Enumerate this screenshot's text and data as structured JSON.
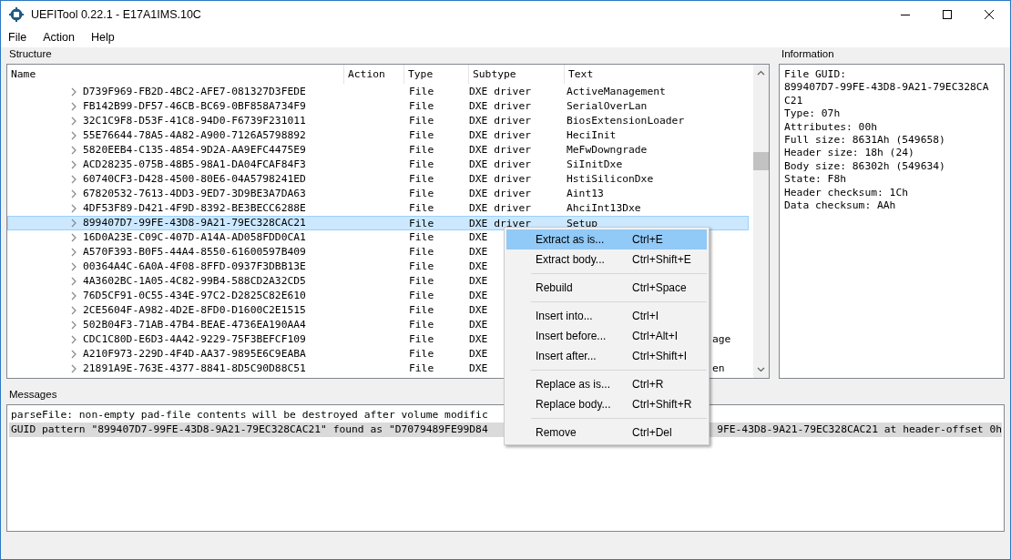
{
  "window": {
    "title": "UEFITool 0.22.1 - E17A1IMS.10C"
  },
  "menu_bar": [
    "File",
    "Action",
    "Help"
  ],
  "structure": {
    "label": "Structure",
    "columns": [
      "Name",
      "Action",
      "Type",
      "Subtype",
      "Text"
    ],
    "rows": [
      {
        "name": "D739F969-FB2D-4BC2-AFE7-081327D3FEDE",
        "type": "File",
        "subtype": "DXE driver",
        "text": "ActiveManagement",
        "selected": false
      },
      {
        "name": "FB142B99-DF57-46CB-BC69-0BF858A734F9",
        "type": "File",
        "subtype": "DXE driver",
        "text": "SerialOverLan",
        "selected": false
      },
      {
        "name": "32C1C9F8-D53F-41C8-94D0-F6739F231011",
        "type": "File",
        "subtype": "DXE driver",
        "text": "BiosExtensionLoader",
        "selected": false
      },
      {
        "name": "55E76644-78A5-4A82-A900-7126A5798892",
        "type": "File",
        "subtype": "DXE driver",
        "text": "HeciInit",
        "selected": false
      },
      {
        "name": "5820EEB4-C135-4854-9D2A-AA9EFC4475E9",
        "type": "File",
        "subtype": "DXE driver",
        "text": "MeFwDowngrade",
        "selected": false
      },
      {
        "name": "ACD28235-075B-48B5-98A1-DA04FCAF84F3",
        "type": "File",
        "subtype": "DXE driver",
        "text": "SiInitDxe",
        "selected": false
      },
      {
        "name": "60740CF3-D428-4500-80E6-04A5798241ED",
        "type": "File",
        "subtype": "DXE driver",
        "text": "HstiSiliconDxe",
        "selected": false
      },
      {
        "name": "67820532-7613-4DD3-9ED7-3D9BE3A7DA63",
        "type": "File",
        "subtype": "DXE driver",
        "text": "Aint13",
        "selected": false
      },
      {
        "name": "4DF53F89-D421-4F9D-8392-BE3BECC6288E",
        "type": "File",
        "subtype": "DXE driver",
        "text": "AhciInt13Dxe",
        "selected": false
      },
      {
        "name": "899407D7-99FE-43D8-9A21-79EC328CAC21",
        "type": "File",
        "subtype": "DXE driver",
        "text": "Setup",
        "selected": true
      },
      {
        "name": "16D0A23E-C09C-407D-A14A-AD058FDD0CA1",
        "type": "File",
        "subtype": "DXE",
        "selected": false
      },
      {
        "name": "A570F393-B0F5-44A4-8550-61600597B409",
        "type": "File",
        "subtype": "DXE",
        "selected": false
      },
      {
        "name": "00364A4C-6A0A-4F08-8FFD-0937F3DBB13E",
        "type": "File",
        "subtype": "DXE",
        "selected": false
      },
      {
        "name": "4A3602BC-1A05-4C82-99B4-588CD2A32CD5",
        "type": "File",
        "subtype": "DXE",
        "selected": false
      },
      {
        "name": "76D5CF91-0C55-434E-97C2-D2825C82E610",
        "type": "File",
        "subtype": "DXE",
        "selected": false
      },
      {
        "name": "2CE5604F-A982-4D2E-8FD0-D1600C2E1515",
        "type": "File",
        "subtype": "DXE",
        "selected": false
      },
      {
        "name": "502B04F3-71AB-47B4-BEAE-4736EA190AA4",
        "type": "File",
        "subtype": "DXE",
        "selected": false
      },
      {
        "name": "CDC1C80D-E6D3-4A42-9229-75F3BEFCF109",
        "type": "File",
        "subtype": "DXE",
        "text_after_menu": "age",
        "selected": false
      },
      {
        "name": "A210F973-229D-4F4D-AA37-9895E6C9EABA",
        "type": "File",
        "subtype": "DXE",
        "selected": false
      },
      {
        "name": "21891A9E-763E-4377-8841-8D5C90D88C51",
        "type": "File",
        "subtype": "DXE",
        "text_after_menu": "en",
        "selected": false
      }
    ]
  },
  "information": {
    "label": "Information",
    "lines": [
      "File GUID:",
      "899407D7-99FE-43D8-9A21-79EC328CA",
      "C21",
      "Type: 07h",
      "Attributes: 00h",
      "Full size: 8631Ah (549658)",
      "Header size: 18h (24)",
      "Body size: 86302h (549634)",
      "State: F8h",
      "Header checksum: 1Ch",
      "Data checksum: AAh"
    ]
  },
  "messages": {
    "label": "Messages",
    "lines": [
      {
        "parts": [
          "parseFile: non-empty pad-file contents will be destroyed after volume modific"
        ],
        "selected": false
      },
      {
        "parts": [
          "GUID pattern \"899407D7-99FE-43D8-9A21-79EC328CAC21\" found as \"D7079489FE99D84",
          "9FE-43D8-9A21-79EC328CAC21 at header-offset 0h"
        ],
        "selected": true
      }
    ]
  },
  "context_menu": {
    "items": [
      {
        "kind": "item",
        "label": "Extract as is...",
        "shortcut": "Ctrl+E",
        "selected": true
      },
      {
        "kind": "item",
        "label": "Extract body...",
        "shortcut": "Ctrl+Shift+E",
        "selected": false
      },
      {
        "kind": "separator"
      },
      {
        "kind": "item",
        "label": "Rebuild",
        "shortcut": "Ctrl+Space",
        "selected": false
      },
      {
        "kind": "separator"
      },
      {
        "kind": "item",
        "label": "Insert into...",
        "shortcut": "Ctrl+I",
        "selected": false
      },
      {
        "kind": "item",
        "label": "Insert before...",
        "shortcut": "Ctrl+Alt+I",
        "selected": false
      },
      {
        "kind": "item",
        "label": "Insert after...",
        "shortcut": "Ctrl+Shift+I",
        "selected": false
      },
      {
        "kind": "separator"
      },
      {
        "kind": "item",
        "label": "Replace as is...",
        "shortcut": "Ctrl+R",
        "selected": false
      },
      {
        "kind": "item",
        "label": "Replace body...",
        "shortcut": "Ctrl+Shift+R",
        "selected": false
      },
      {
        "kind": "separator"
      },
      {
        "kind": "item",
        "label": "Remove",
        "shortcut": "Ctrl+Del",
        "selected": false
      }
    ]
  }
}
